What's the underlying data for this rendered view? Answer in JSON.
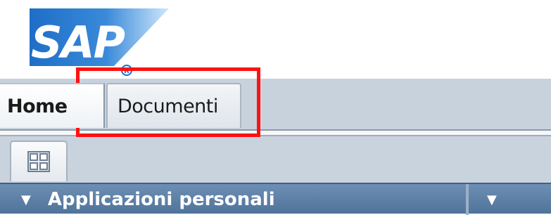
{
  "logo": {
    "text": "SAP",
    "registered_mark": "®",
    "colors": {
      "primary": "#1e6ec8",
      "gradient_start": "#1e6ec8",
      "gradient_end": "#cfe7fb"
    }
  },
  "tabs": [
    {
      "label": "Home",
      "selected": true
    },
    {
      "label": "Documenti",
      "selected": false
    }
  ],
  "toolbar": {
    "grid_icon": "grid-icon"
  },
  "panels": [
    {
      "expand_icon": "▼",
      "title": "Applicazioni personali"
    },
    {
      "expand_icon": "▼",
      "title": ""
    }
  ],
  "annotation": {
    "color": "#ff1111",
    "target": "tab-documenti"
  }
}
